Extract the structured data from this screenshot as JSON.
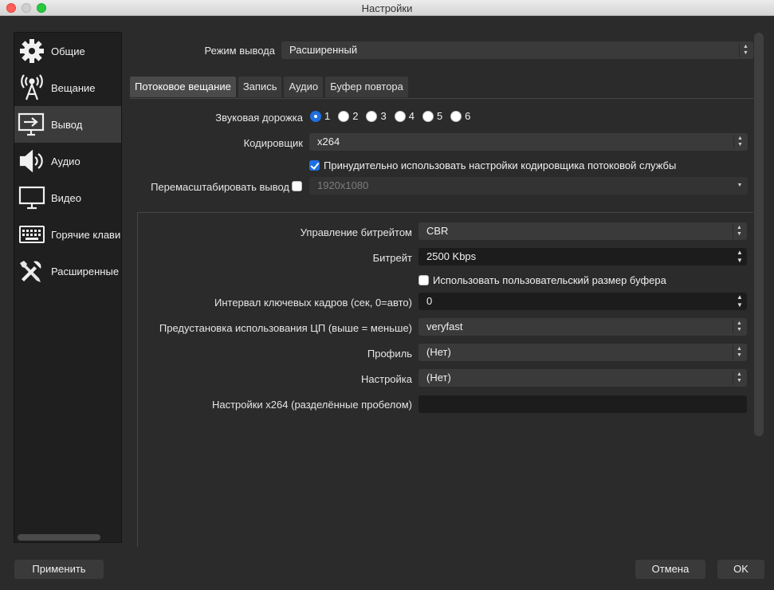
{
  "window": {
    "title": "Настройки"
  },
  "sidebar": {
    "items": [
      {
        "label": "Общие",
        "icon": "gear-icon"
      },
      {
        "label": "Вещание",
        "icon": "broadcast-icon"
      },
      {
        "label": "Вывод",
        "icon": "output-icon",
        "active": true
      },
      {
        "label": "Аудио",
        "icon": "speaker-icon"
      },
      {
        "label": "Видео",
        "icon": "monitor-icon"
      },
      {
        "label": "Горячие клави",
        "icon": "keyboard-icon"
      },
      {
        "label": "Расширенные",
        "icon": "tools-icon"
      }
    ]
  },
  "output_mode": {
    "label": "Режим вывода",
    "value": "Расширенный"
  },
  "tabs": [
    {
      "label": "Потоковое вещание",
      "active": true
    },
    {
      "label": "Запись"
    },
    {
      "label": "Аудио"
    },
    {
      "label": "Буфер повтора"
    }
  ],
  "streaming": {
    "audio_track_label": "Звуковая дорожка",
    "tracks": [
      "1",
      "2",
      "3",
      "4",
      "5",
      "6"
    ],
    "selected_track": "1",
    "encoder_label": "Кодировщик",
    "encoder_value": "x264",
    "enforce_label": "Принудительно использовать настройки кодировщика потоковой службы",
    "enforce_checked": true,
    "rescale_label": "Перемасштабировать вывод",
    "rescale_checked": false,
    "rescale_value": "1920x1080"
  },
  "encoder_settings": {
    "rate_control_label": "Управление битрейтом",
    "rate_control_value": "CBR",
    "bitrate_label": "Битрейт",
    "bitrate_value": "2500 Kbps",
    "custom_buffer_label": "Использовать пользовательский размер буфера",
    "custom_buffer_checked": false,
    "keyframe_label": "Интервал ключевых кадров (сек, 0=авто)",
    "keyframe_value": "0",
    "cpu_preset_label": "Предустановка использования ЦП (выше = меньше)",
    "cpu_preset_value": "veryfast",
    "profile_label": "Профиль",
    "profile_value": "(Нет)",
    "tune_label": "Настройка",
    "tune_value": "(Нет)",
    "x264opts_label": "Настройки x264 (разделённые пробелом)",
    "x264opts_value": ""
  },
  "buttons": {
    "apply": "Применить",
    "cancel": "Отмена",
    "ok": "OK"
  },
  "colors": {
    "accent": "#1e6fe0",
    "background": "#2b2b2b",
    "sidebar": "#1f1f1f"
  }
}
